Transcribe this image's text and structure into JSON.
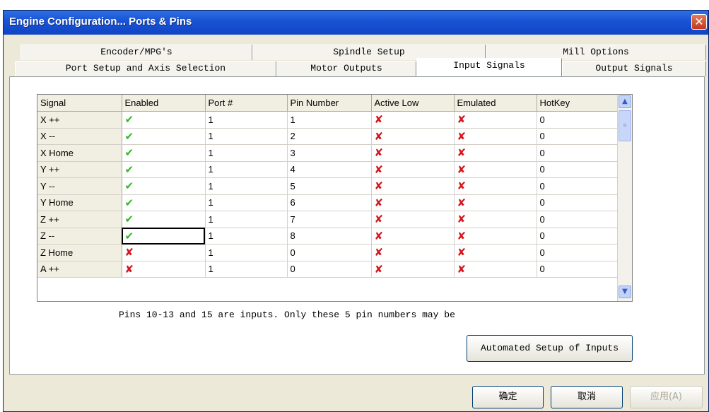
{
  "window": {
    "title": "Engine Configuration... Ports & Pins",
    "close_glyph": "✕"
  },
  "tabs": {
    "row1": [
      "Encoder/MPG's",
      "Spindle Setup",
      "Mill Options"
    ],
    "row2": [
      "Port Setup and Axis Selection",
      "Motor Outputs",
      "Input Signals",
      "Output Signals"
    ],
    "active": "Input Signals"
  },
  "grid": {
    "headers": [
      "Signal",
      "Enabled",
      "Port #",
      "Pin Number",
      "Active Low",
      "Emulated",
      "HotKey"
    ],
    "rows": [
      {
        "signal": "X ++",
        "enabled": true,
        "port": "1",
        "pin": "1",
        "active_low": false,
        "emulated": false,
        "hotkey": "0"
      },
      {
        "signal": "X --",
        "enabled": true,
        "port": "1",
        "pin": "2",
        "active_low": false,
        "emulated": false,
        "hotkey": "0"
      },
      {
        "signal": "X Home",
        "enabled": true,
        "port": "1",
        "pin": "3",
        "active_low": false,
        "emulated": false,
        "hotkey": "0"
      },
      {
        "signal": "Y ++",
        "enabled": true,
        "port": "1",
        "pin": "4",
        "active_low": false,
        "emulated": false,
        "hotkey": "0"
      },
      {
        "signal": "Y --",
        "enabled": true,
        "port": "1",
        "pin": "5",
        "active_low": false,
        "emulated": false,
        "hotkey": "0"
      },
      {
        "signal": "Y Home",
        "enabled": true,
        "port": "1",
        "pin": "6",
        "active_low": false,
        "emulated": false,
        "hotkey": "0"
      },
      {
        "signal": "Z ++",
        "enabled": true,
        "port": "1",
        "pin": "7",
        "active_low": false,
        "emulated": false,
        "hotkey": "0"
      },
      {
        "signal": "Z --",
        "enabled": true,
        "port": "1",
        "pin": "8",
        "active_low": false,
        "emulated": false,
        "hotkey": "0"
      },
      {
        "signal": "Z Home",
        "enabled": false,
        "port": "1",
        "pin": "0",
        "active_low": false,
        "emulated": false,
        "hotkey": "0"
      },
      {
        "signal": "A ++",
        "enabled": false,
        "port": "1",
        "pin": "0",
        "active_low": false,
        "emulated": false,
        "hotkey": "0"
      }
    ],
    "check_glyph": "✔",
    "cross_glyph": "✘",
    "check_color": "#2fb81f",
    "cross_color": "#d2161b"
  },
  "note": "Pins 10-13 and 15 are inputs. Only these 5 pin numbers may be",
  "buttons": {
    "automated": "Automated Setup of Inputs",
    "ok": "确定",
    "cancel": "取消",
    "apply": "应用(A)"
  },
  "scroll_icons": {
    "up": "▲",
    "down": "▼",
    "thumb": "≡"
  },
  "colors": {
    "titlebar": "#1a55d6",
    "dialog_bg": "#ece9d8"
  }
}
